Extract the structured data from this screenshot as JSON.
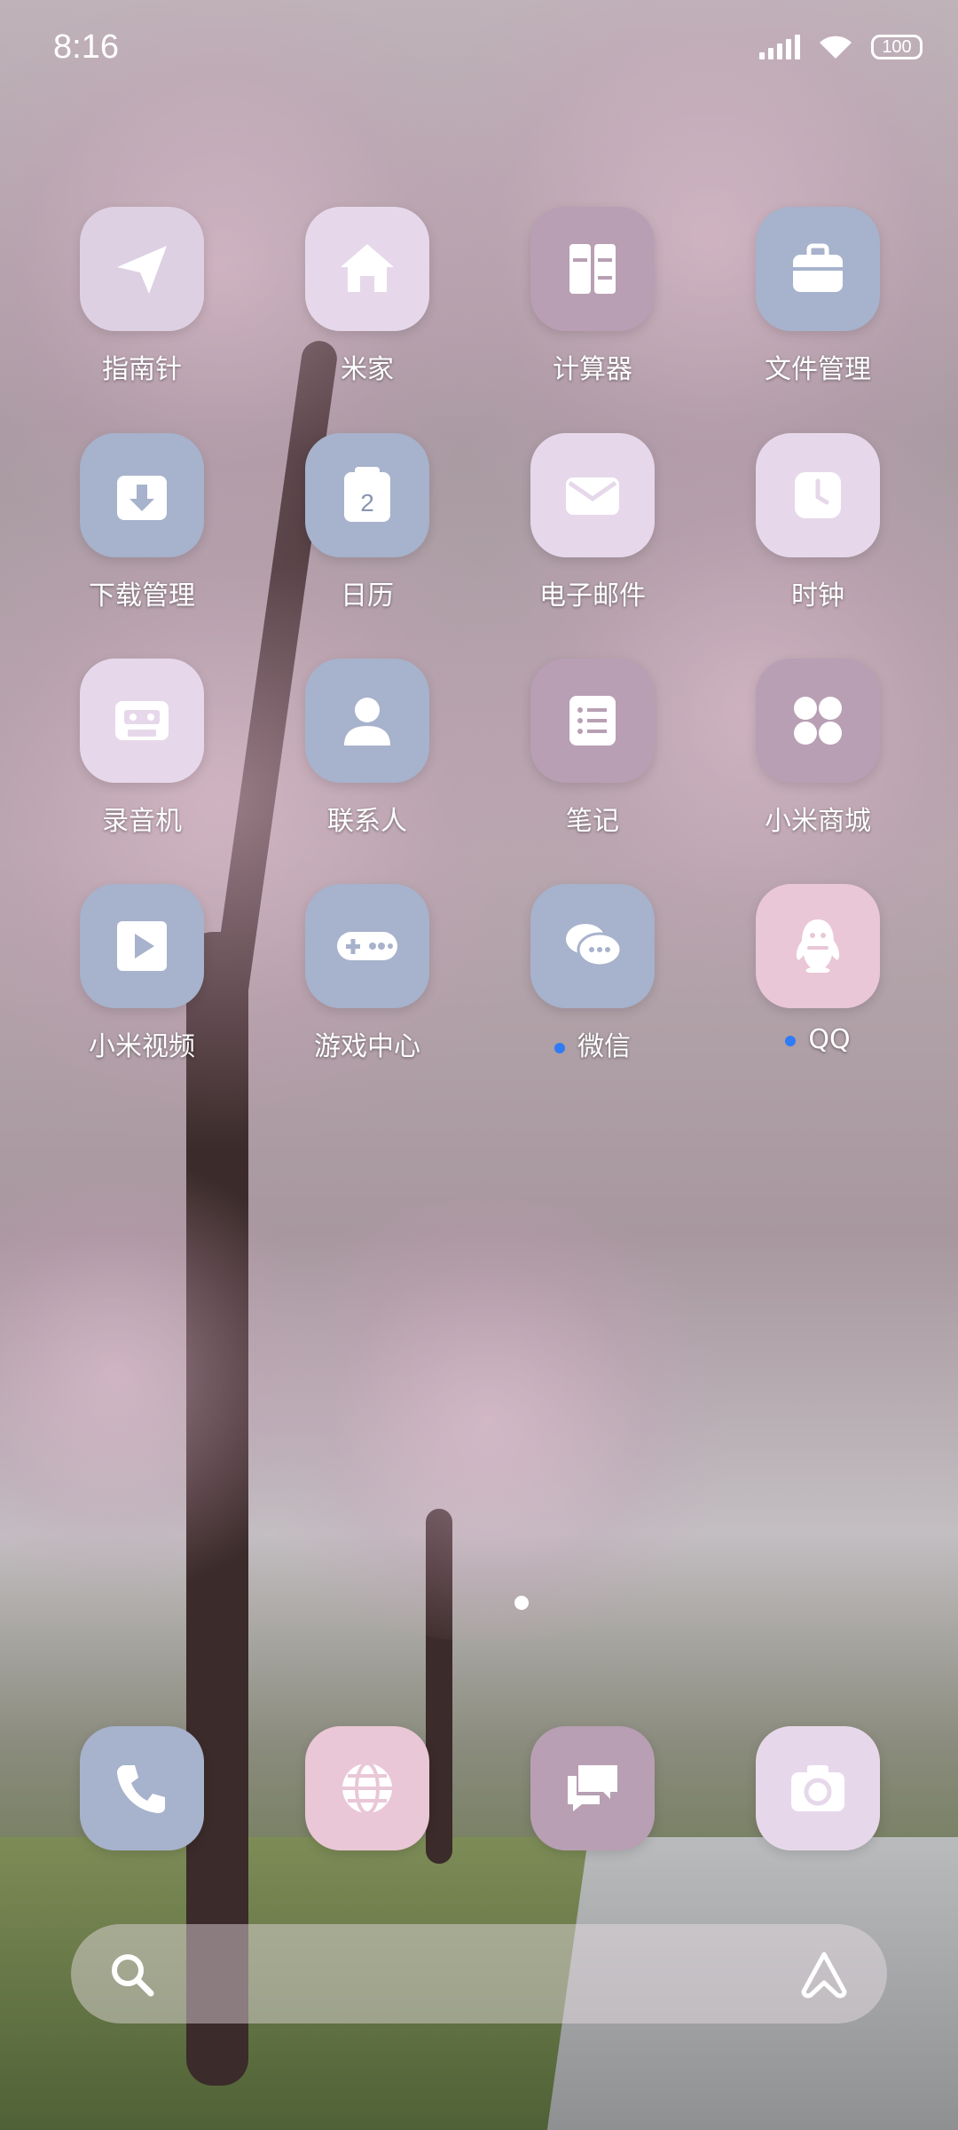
{
  "status_bar": {
    "time": "8:16",
    "battery": "100"
  },
  "apps": [
    {
      "label": "指南针",
      "icon": "compass-icon"
    },
    {
      "label": "米家",
      "icon": "home-icon"
    },
    {
      "label": "计算器",
      "icon": "calculator-icon"
    },
    {
      "label": "文件管理",
      "icon": "briefcase-icon"
    },
    {
      "label": "下载管理",
      "icon": "download-box-icon"
    },
    {
      "label": "日历",
      "icon": "calendar-icon",
      "badge_text": "2"
    },
    {
      "label": "电子邮件",
      "icon": "mail-icon"
    },
    {
      "label": "时钟",
      "icon": "clock-icon"
    },
    {
      "label": "录音机",
      "icon": "cassette-icon"
    },
    {
      "label": "联系人",
      "icon": "person-icon"
    },
    {
      "label": "笔记",
      "icon": "notes-icon"
    },
    {
      "label": "小米商城",
      "icon": "four-dots-icon"
    },
    {
      "label": "小米视频",
      "icon": "play-icon"
    },
    {
      "label": "游戏中心",
      "icon": "gamepad-icon"
    },
    {
      "label": "微信",
      "icon": "chat-bubbles-icon",
      "new_dot": true
    },
    {
      "label": "QQ",
      "icon": "penguin-icon",
      "new_dot": true
    }
  ],
  "dock": [
    {
      "icon": "phone-icon"
    },
    {
      "icon": "globe-icon"
    },
    {
      "icon": "messages-icon"
    },
    {
      "icon": "camera-icon"
    }
  ],
  "colors": {
    "icon_pink": "#e9c7d6",
    "icon_lilac": "#ddd0e3",
    "icon_mauve": "#b89fb3",
    "icon_blue": "#a7b2cc",
    "new_dot": "#2f7cf6"
  }
}
